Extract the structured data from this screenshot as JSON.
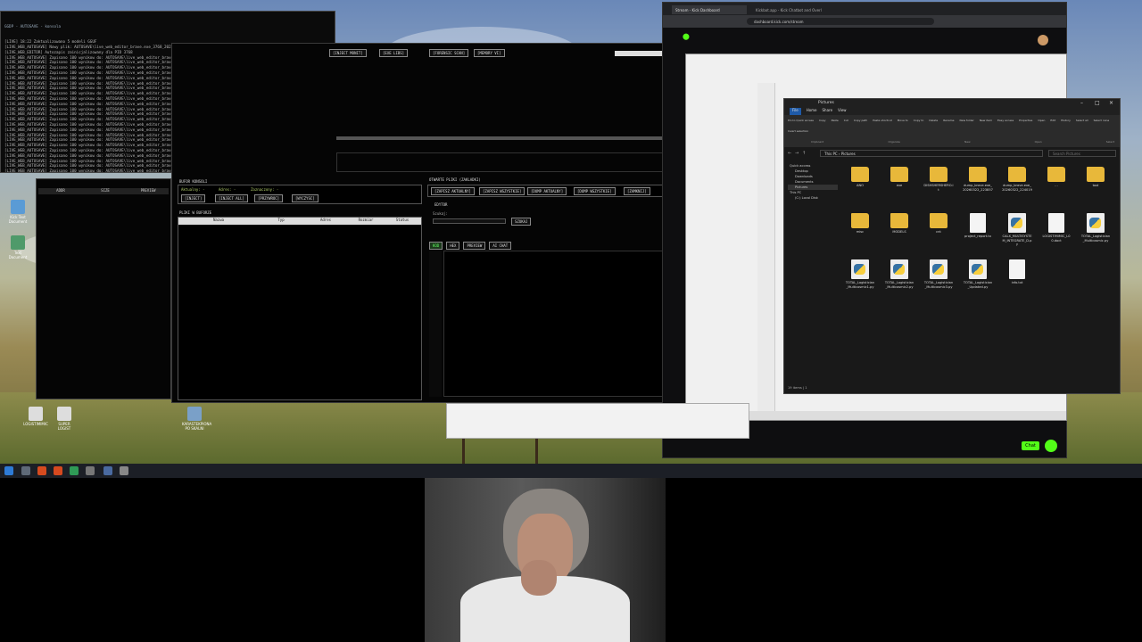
{
  "console": {
    "title": "GGDP - AUTOSAVE - konsola",
    "lines": [
      "[LIVE] 18:22 Zaktualizowano 5 modeli GGUF",
      "[LIVE_WEB_AUTOSAVE] Nowy plik: AUTOSAVE\\live_web_editor_brave.exe_3768_20250324_075448.jsonl",
      "[LIVE_WEB_EDITOR] Autozapis zainicjalizowany dla PID 3768",
      "[LIVE_WEB_AUTOSAVE] Zapisano 100 wynikow do: AUTOSAVE\\live_web_editor_brave.exe_3768_20250324_075448.jsonl",
      "[LIVE_WEB_AUTOSAVE] Zapisano 100 wynikow do: AUTOSAVE\\live_web_editor_brave.exe_3768_20250324_075448.jsonl",
      "[LIVE_WEB_AUTOSAVE] Zapisano 100 wynikow do: AUTOSAVE\\live_web_editor_brave.exe_3768_20250324_075448.jsonl",
      "[LIVE_WEB_AUTOSAVE] Zapisano 100 wynikow do: AUTOSAVE\\live_web_editor_brave.exe_3768_20250324_075448.jsonl",
      "[LIVE_WEB_AUTOSAVE] Zapisano 100 wynikow do: AUTOSAVE\\live_web_editor_brave.exe_3768_20250324_075448.jsonl",
      "[LIVE_WEB_AUTOSAVE] Zapisano 100 wynikow do: AUTOSAVE\\live_web_editor_brave.exe_3768_20250324_075448.jsonl",
      "[LIVE_WEB_AUTOSAVE] Zapisano 100 wynikow do: AUTOSAVE\\live_web_editor_brave.exe_3768_20250324_075448.jsonl",
      "[LIVE_WEB_AUTOSAVE] Zapisano 100 wynikow do: AUTOSAVE\\live_web_editor_brave.exe_3768_20250324_075448.jsonl",
      "[LIVE_WEB_AUTOSAVE] Zapisano 100 wynikow do: AUTOSAVE\\live_web_editor_brave.exe_3768_20250324_075448.jsonl",
      "[LIVE_WEB_AUTOSAVE] Zapisano 100 wynikow do: AUTOSAVE\\live_web_editor_brave.exe_3768_20250324_075448.jsonl",
      "[LIVE_WEB_AUTOSAVE] Zapisano 100 wynikow do: AUTOSAVE\\live_web_editor_brave.exe_3768_20250324_075448.jsonl",
      "[LIVE_WEB_AUTOSAVE] Zapisano 100 wynikow do: AUTOSAVE\\live_web_editor_brave.exe_3768_20250324_075448.jsonl",
      "[LIVE_WEB_AUTOSAVE] Zapisano 100 wynikow do: AUTOSAVE\\live_web_editor_brave.exe_3768_20250324_075448.jsonl",
      "[LIVE_WEB_AUTOSAVE] Zapisano 100 wynikow do: AUTOSAVE\\live_web_editor_brave.exe_3768_20250324_075448.jsonl",
      "[LIVE_WEB_AUTOSAVE] Zapisano 100 wynikow do: AUTOSAVE\\live_web_editor_brave.exe_3768_20250324_075448.jsonl",
      "[LIVE_WEB_AUTOSAVE] Zapisano 100 wynikow do: AUTOSAVE\\live_web_editor_brave.exe_3768_20250324_075448.jsonl",
      "[LIVE_WEB_AUTOSAVE] Zapisano 100 wynikow do: AUTOSAVE\\live_web_editor_brave.exe_3768_20250324_075448.jsonl",
      "[LIVE_WEB_AUTOSAVE] Zapisano 100 wynikow do: AUTOSAVE\\live_web_editor_brave.exe_3768_20250324_075448.jsonl",
      "[LIVE_WEB_AUTOSAVE] Zapisano 100 wynikow do: AUTOSAVE\\live_web_editor_brave.exe_3768_20250324_075448.jsonl",
      "[LIVE_WEB_AUTOSAVE] Zapisano 100 wynikow do: AUTOSAVE\\live_web_editor_brave.exe_3768_20250324_075448.jsonl",
      "[LIVE_WEB_AUTOSAVE] Zapisano 100 wynikow do: AUTOSAVE\\live_web_editor_brave.exe_3768_20250324_075448.jsonl",
      "[LIVE_WEB_AUTOSAVE] Zapisano 100 wynikow do: AUTOSAVE\\live_web_editor_brave.exe_3768_20250324_075448.jsonl",
      "[LIVE_WEB_AUTOSAVE] Zapisano 100 wynikow do: AUTOSAVE\\live_web_editor_brave.exe_3768_20250324_075448.jsonl",
      "[LIVE_WEB_AUTOSAVE] Zapisano 100 wynikow do: AUTOSAVE\\live_web_editor_brave.exe_3768_20250324_075448.jsonl",
      "[LIVE_WEB_AUTOSAVE] Zapisano 100 wynikow do: AUTOSAVE\\live_web_editor_brave.exe_3768_20250324_075448.jsonl",
      "[LIVE_WEB_AUTOSAVE] Zapisano 100 wynikow do: AUTOSAVE\\live_web_editor_brave.exe_3768_20250324_075448.jsonl",
      "[LIVE_WEB_AUTOSAVE] Zapisano 100 wynikow do: AUTOSAVE\\live_web_editor_brave.exe_3768_20250324_075448.jsonl"
    ]
  },
  "editor": {
    "top_buttons": [
      "[INJECT MONIT]",
      "[EXE LIBS]",
      "[FORENSIC SCAN]",
      "[MEMORY VI]"
    ],
    "process_title": "BUFOR KONSOLI",
    "process_fields": [
      "Aktualny: -",
      "Adres: -",
      "Zaznaczony: -"
    ],
    "process_buttons": [
      "[INJECT]",
      "[INJECT ALL]",
      "[PRZYWROC]",
      "[WYCZYSC]"
    ],
    "files_title": "PLIKI W BUFORZE",
    "files_columns": [
      "Nazwa",
      "Typ",
      "Adres",
      "Rozmiar",
      "Status"
    ],
    "open_title": "OTWARTE PLIKI (ZAKLADKI)",
    "open_buttons": [
      "[ZAPISZ AKTUALNY]",
      "[ZAPISZ WSZYSTKIE]",
      "[DUMP AKTUALNY]",
      "[DUMP WSZYSTKIE]",
      "[ZAMKNIJ]"
    ],
    "editor_title": "EDYTOR",
    "search_label": "Szukaj:",
    "search_button": "SZUKAJ",
    "tabs": [
      "KOD",
      "HEX",
      "PREVIEW",
      "AI CHAT"
    ],
    "left_headers": [
      "ADDR",
      "SIZE",
      "PREVIEW"
    ]
  },
  "browser": {
    "tabs": [
      "Stream - Kick Dashboard",
      "Kickbot.app - Kick Chatbot and Overl"
    ],
    "url": "dashboard.kick.com/stream",
    "chat_button": "Chat"
  },
  "explorer": {
    "title": "Pictures",
    "ribbon_tabs": [
      "File",
      "Home",
      "Share",
      "View"
    ],
    "ribbon_items": [
      "Pin to Quick access",
      "Copy",
      "Paste",
      "Cut",
      "Copy path",
      "Paste shortcut",
      "Move to",
      "Copy to",
      "Delete",
      "Rename",
      "New folder",
      "New item",
      "Easy access",
      "Properties",
      "Open",
      "Edit",
      "History",
      "Select all",
      "Select none",
      "Invert selection"
    ],
    "ribbon_groups": [
      "Clipboard",
      "Organize",
      "New",
      "Open",
      "Select"
    ],
    "path": [
      "This PC",
      "Pictures"
    ],
    "search_placeholder": "Search Pictures",
    "nav": [
      "Quick access",
      "Desktop",
      "Downloads",
      "Documents",
      "Pictures",
      "This PC",
      "(C:) Local Disk"
    ],
    "files": [
      {
        "name": "ANO",
        "kind": "folder"
      },
      {
        "name": "exe",
        "kind": "folder"
      },
      {
        "name": "DISHSHERSHERO.lt",
        "kind": "folder"
      },
      {
        "name": "dump_brave.exe_20260322_223857",
        "kind": "folder"
      },
      {
        "name": "dump_brave.exe_20260322_224019",
        "kind": "folder"
      },
      {
        "name": "...",
        "kind": "folder"
      },
      {
        "name": "tool",
        "kind": "folder"
      },
      {
        "name": "misc",
        "kind": "folder"
      },
      {
        "name": "MODELS",
        "kind": "folder"
      },
      {
        "name": "cnt",
        "kind": "folder"
      },
      {
        "name": "project_report.tx",
        "kind": "doc"
      },
      {
        "name": "CALX_MULTISYSTEM_INTEGRATE_D.py",
        "kind": "py"
      },
      {
        "name": "LOGISTIMIMIC_L00.doct",
        "kind": "doc"
      },
      {
        "name": "TOTAL_Logistician_Multicosmic.py",
        "kind": "py"
      },
      {
        "name": "TOTAL_Logistician_Multicosmic1.py",
        "kind": "py"
      },
      {
        "name": "TOTAL_Logistician_Multicosmic2.py",
        "kind": "py"
      },
      {
        "name": "TOTAL_Logistician_Multicosmic3.py",
        "kind": "py"
      },
      {
        "name": "TOTAL_Logistician_Updated.py",
        "kind": "py"
      },
      {
        "name": "info.txt",
        "kind": "doc"
      }
    ],
    "status": "19 items | 1"
  },
  "desktop_icons": [
    "Kick Text Document",
    "Text Document",
    "LOGISTIMIMIC",
    "SUPER LOGIST",
    "KARASTEKPIONA PO SKALNI"
  ],
  "colors": {
    "editor_bg": "#050505",
    "accent_green": "#53fc18",
    "folder": "#e8b83a",
    "taskbar": "#1c1f26"
  }
}
